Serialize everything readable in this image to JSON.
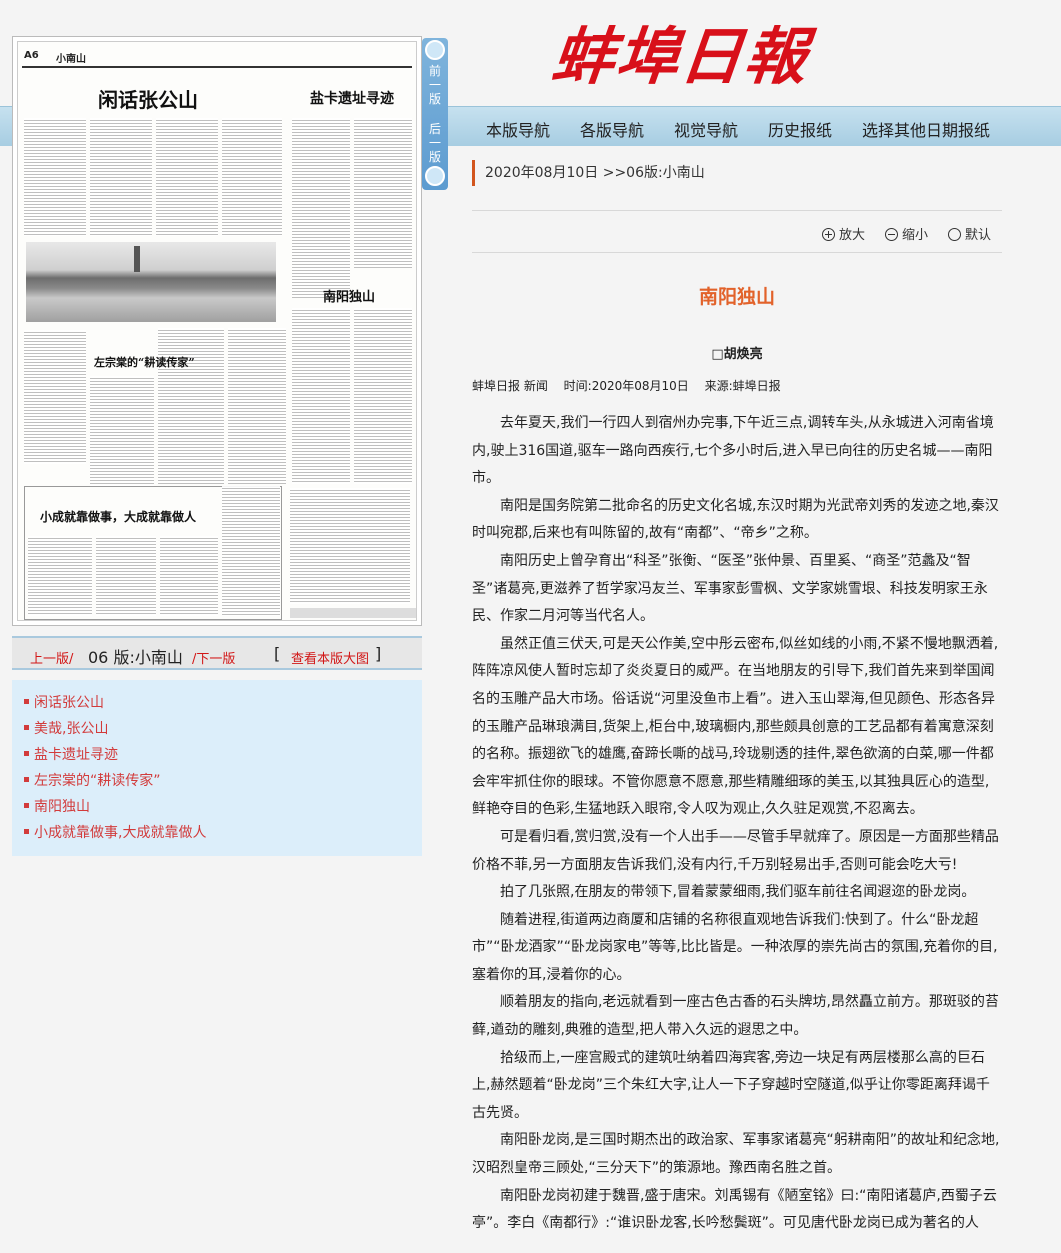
{
  "masthead": {
    "logo_text": "蚌埠日報"
  },
  "nav": {
    "items": [
      "本版导航",
      "各版导航",
      "视觉导航",
      "历史报纸",
      "选择其他日期报纸"
    ]
  },
  "side_buttons": {
    "prev": "前一版",
    "next": "后一版"
  },
  "thumbnail": {
    "page_no": "A6",
    "page_name": "小南山",
    "headlines": {
      "h1": "闲话张公山",
      "h2": "盐卡遗址寻迹",
      "h3": "南阳独山",
      "h4": "左宗棠的“耕读传家”",
      "h5": "小成就靠做事，大成就靠做人"
    }
  },
  "pagebar": {
    "prev": "上一版/",
    "current": "06 版:小南山",
    "next": "/下一版",
    "bracket_open": "[",
    "bigimg": "查看本版大图",
    "bracket_close": "]"
  },
  "article_list": [
    "闲话张公山",
    "美哉,张公山",
    "盐卡遗址寻迹",
    "左宗棠的“耕读传家”",
    "南阳独山",
    "小成就靠做事,大成就靠做人"
  ],
  "crumb": "2020年08月10日  >>06版:小南山",
  "zoom": {
    "enlarge": "放大",
    "shrink": "缩小",
    "default": "默认"
  },
  "article": {
    "title": "南阳独山",
    "author": "□胡焕亮",
    "meta": {
      "source_name": "蚌埠日报 新闻",
      "time": "时间:2020年08月10日",
      "from": "来源:蚌埠日报"
    },
    "paragraphs": [
      "去年夏天,我们一行四人到宿州办完事,下午近三点,调转车头,从永城进入河南省境内,驶上316国道,驱车一路向西疾行,七个多小时后,进入早已向往的历史名城——南阳市。",
      "南阳是国务院第二批命名的历史文化名城,东汉时期为光武帝刘秀的发迹之地,秦汉时叫宛郡,后来也有叫陈留的,故有“南都”、“帝乡”之称。",
      "南阳历史上曾孕育出“科圣”张衡、“医圣”张仲景、百里奚、“商圣”范蠡及“智圣”诸葛亮,更滋养了哲学家冯友兰、军事家彭雪枫、文学家姚雪垠、科技发明家王永民、作家二月河等当代名人。",
      "虽然正值三伏天,可是天公作美,空中彤云密布,似丝如线的小雨,不紧不慢地飘洒着,阵阵凉风使人暂时忘却了炎炎夏日的威严。在当地朋友的引导下,我们首先来到举国闻名的玉雕产品大市场。俗话说“河里没鱼市上看”。进入玉山翠海,但见颜色、形态各异的玉雕产品琳琅满目,货架上,柜台中,玻璃橱内,那些颇具创意的工艺品都有着寓意深刻的名称。振翅欲飞的雄鹰,奋蹄长嘶的战马,玲珑剔透的挂件,翠色欲滴的白菜,哪一件都会牢牢抓住你的眼球。不管你愿意不愿意,那些精雕细琢的美玉,以其独具匠心的造型,鲜艳夺目的色彩,生猛地跃入眼帘,令人叹为观止,久久驻足观赏,不忍离去。",
      "可是看归看,赏归赏,没有一个人出手——尽管手早就痒了。原因是一方面那些精品价格不菲,另一方面朋友告诉我们,没有内行,千万别轻易出手,否则可能会吃大亏!",
      "拍了几张照,在朋友的带领下,冒着蒙蒙细雨,我们驱车前往名闻遐迩的卧龙岗。",
      "随着进程,街道两边商厦和店铺的名称很直观地告诉我们:快到了。什么“卧龙超市”“卧龙酒家”“卧龙岗家电”等等,比比皆是。一种浓厚的崇先尚古的氛围,充着你的目,塞着你的耳,浸着你的心。",
      "顺着朋友的指向,老远就看到一座古色古香的石头牌坊,昂然矗立前方。那斑驳的苔藓,遒劲的雕刻,典雅的造型,把人带入久远的遐思之中。",
      "拾级而上,一座宫殿式的建筑吐纳着四海宾客,旁边一块足有两层楼那么高的巨石上,赫然题着“卧龙岗”三个朱红大字,让人一下子穿越时空隧道,似乎让你零距离拜谒千古先贤。",
      "南阳卧龙岗,是三国时期杰出的政治家、军事家诸葛亮“躬耕南阳”的故址和纪念地,汉昭烈皇帝三顾处,“三分天下”的策源地。豫西南名胜之首。",
      "南阳卧龙岗初建于魏晋,盛于唐宋。刘禹锡有《陋室铭》曰:“南阳诸葛庐,西蜀子云亭”。李白《南都行》:“谁识卧龙客,长吟愁鬓斑”。可见唐代卧龙岗已成为著名的人"
    ]
  }
}
